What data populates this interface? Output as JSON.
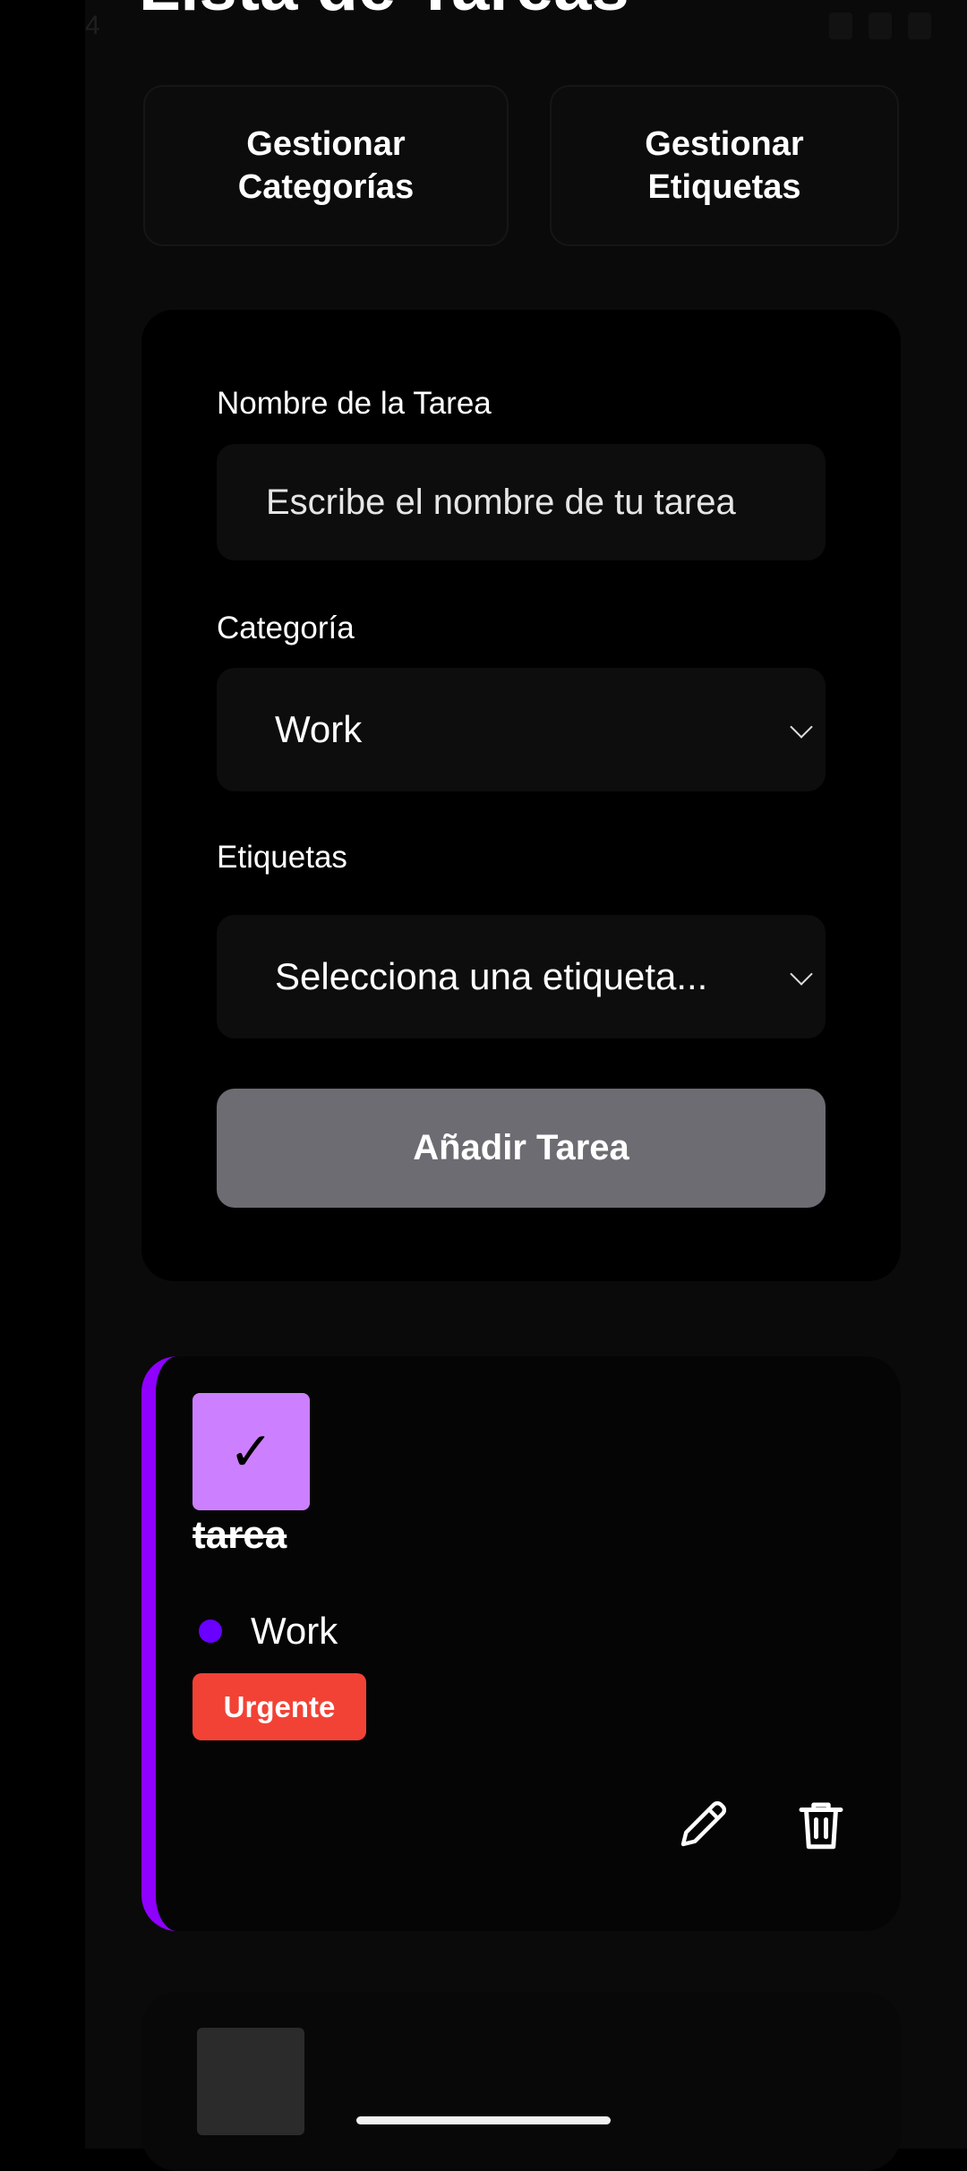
{
  "header": {
    "title": "Lista de Tareas"
  },
  "status_bar": {
    "time": "4"
  },
  "manage": {
    "categories_label": "Gestionar\nCategorías",
    "tags_label": "Gestionar\nEtiquetas"
  },
  "form": {
    "task_name_label": "Nombre de la Tarea",
    "task_name_placeholder": "Escribe el nombre de tu tarea",
    "category_label": "Categoría",
    "category_value": "Work",
    "tags_label": "Etiquetas",
    "tags_value": "Selecciona una etiqueta...",
    "add_button": "Añadir Tarea"
  },
  "tasks": [
    {
      "check_mark": "✓",
      "name": "tarea",
      "completed": true,
      "category": "Work",
      "category_color": "#6a00ff",
      "tag": "Urgente",
      "tag_color": "#f24236",
      "accent_color": "#8f00ff"
    }
  ],
  "icons": {
    "edit": "pencil-icon",
    "delete": "trash-icon",
    "dropdown": "chevron-down-icon"
  }
}
